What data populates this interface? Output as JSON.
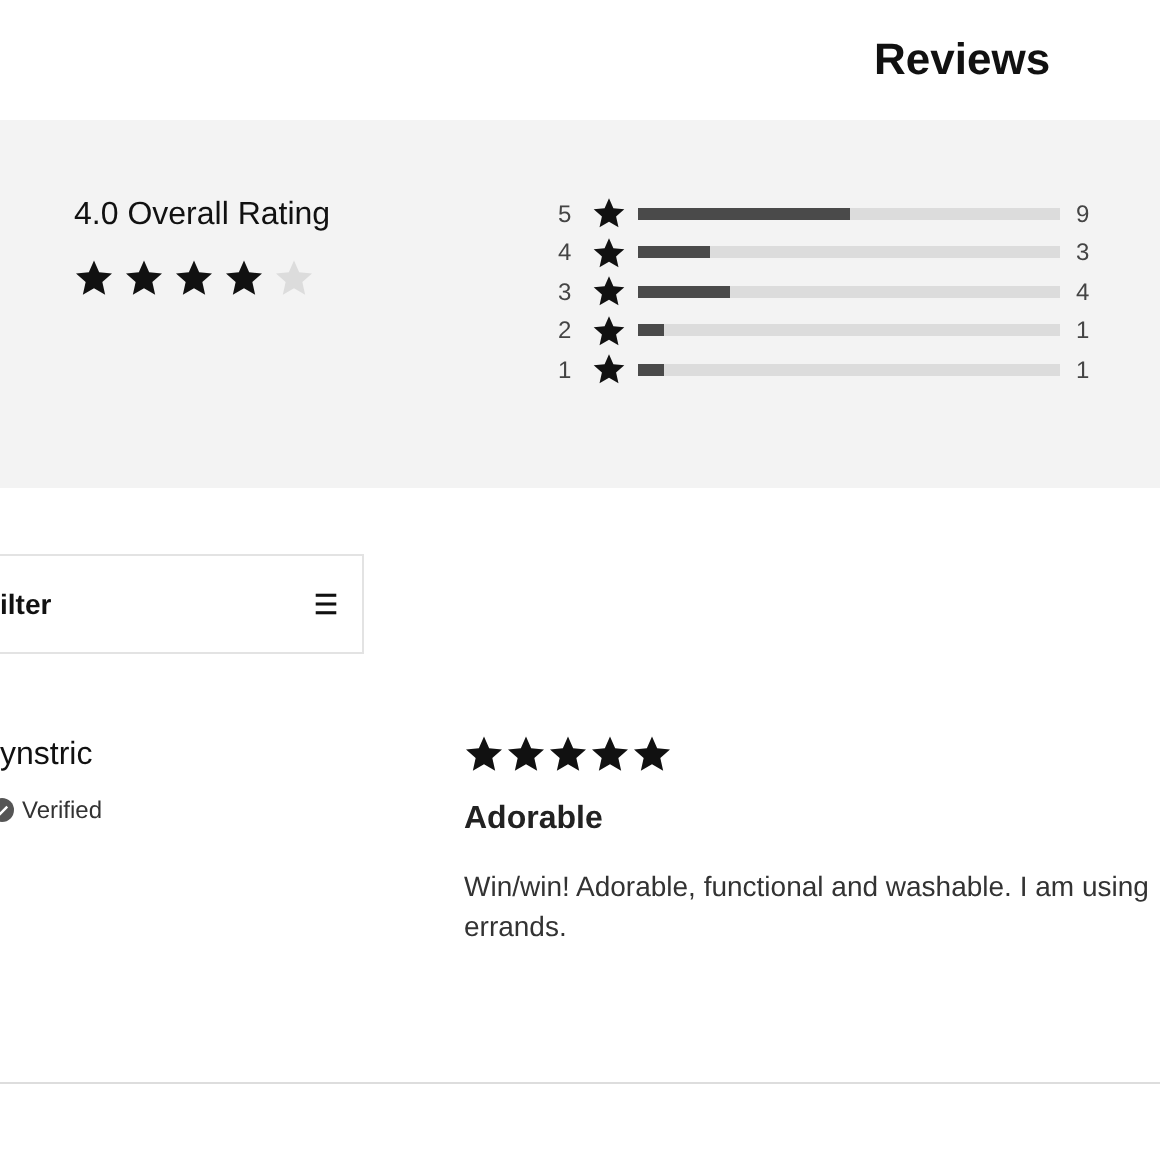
{
  "title": "Reviews",
  "summary": {
    "rating_label": "4.0 Overall Rating",
    "stars": 4,
    "distribution": [
      {
        "label": "5",
        "level": 0.5,
        "count": "9"
      },
      {
        "label": "4",
        "level": 0.17,
        "count": "3"
      },
      {
        "label": "3",
        "level": 0.22,
        "count": "4"
      },
      {
        "label": "2",
        "level": 0.06,
        "count": "1"
      },
      {
        "label": "1",
        "level": 0.06,
        "count": "1"
      }
    ]
  },
  "filter": {
    "label": "ilter"
  },
  "review": {
    "author": "ynstric",
    "verified": true,
    "verified_label": "Verified",
    "stars": 5,
    "title": "Adorable",
    "body_lines": [
      "Win/win! Adorable, functional and washable. I am using",
      "errands."
    ]
  }
}
